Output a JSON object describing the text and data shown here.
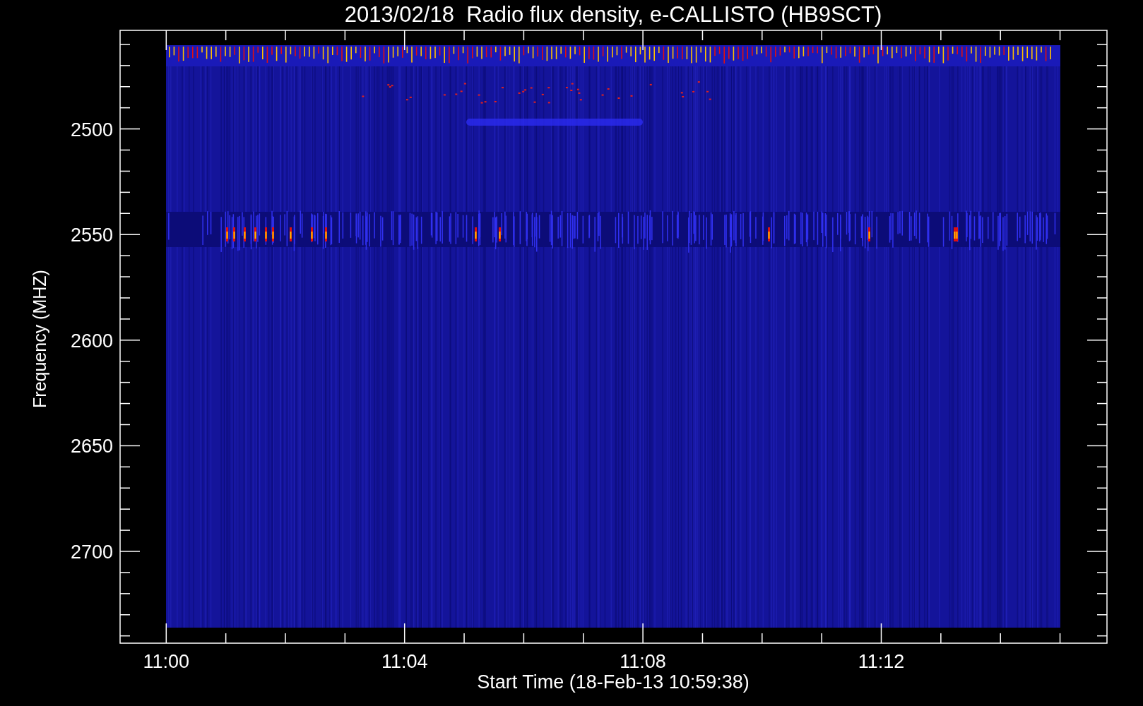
{
  "title": "2013/02/18  Radio flux density, e-CALLISTO (HB9SCT)",
  "y_axis": {
    "label": "Frequency (MHZ)",
    "tick_labels": [
      "2500",
      "2550",
      "2600",
      "2650",
      "2700"
    ]
  },
  "x_axis": {
    "label": "Start Time (18-Feb-13 10:59:38)",
    "tick_labels": [
      "11:00",
      "11:04",
      "11:08",
      "11:12"
    ]
  }
}
